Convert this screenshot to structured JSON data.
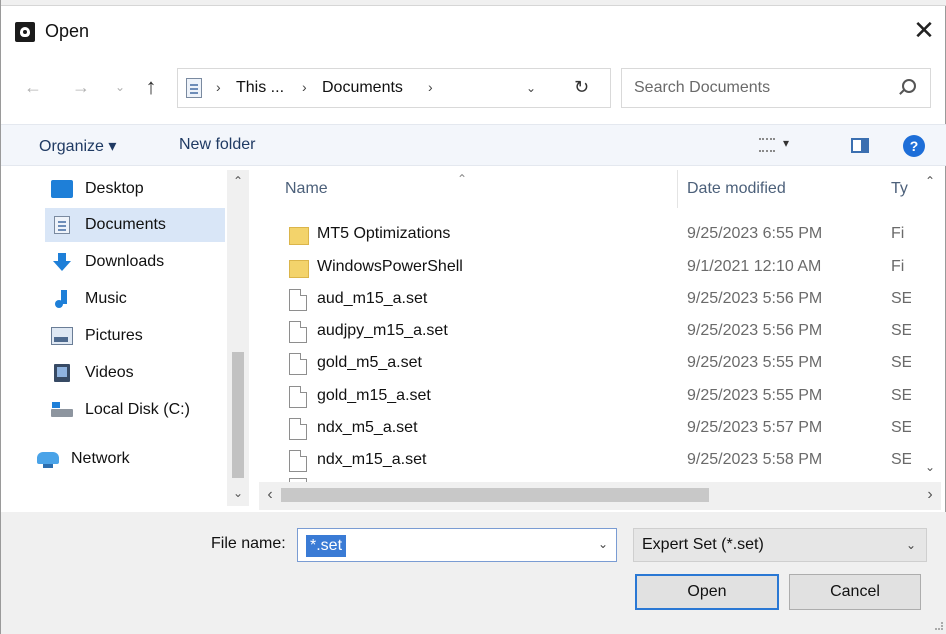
{
  "window": {
    "title": "Open",
    "close_glyph": "✕"
  },
  "nav": {
    "back_glyph": "←",
    "forward_glyph": "→",
    "recent_glyph": "⌄",
    "up_glyph": "↑",
    "breadcrumb": [
      "This ...",
      "Documents"
    ],
    "breadcrumb_sep": "›",
    "dropdown_glyph": "⌄",
    "refresh_glyph": "↻",
    "search_placeholder": "Search Documents"
  },
  "toolbar": {
    "organize_label": "Organize ▾",
    "new_folder_label": "New folder",
    "view_caret": "▾",
    "help_label": "?"
  },
  "sidebar": {
    "items": [
      {
        "label": "Desktop",
        "icon": "desktop-icon"
      },
      {
        "label": "Documents",
        "icon": "documents-icon",
        "selected": true
      },
      {
        "label": "Downloads",
        "icon": "downloads-icon"
      },
      {
        "label": "Music",
        "icon": "music-icon"
      },
      {
        "label": "Pictures",
        "icon": "pictures-icon"
      },
      {
        "label": "Videos",
        "icon": "videos-icon"
      },
      {
        "label": "Local Disk (C:)",
        "icon": "local-disk-icon"
      },
      {
        "label": "Network",
        "icon": "network-icon"
      }
    ],
    "scroll_up": "⌃",
    "scroll_down": "⌄"
  },
  "files": {
    "columns": {
      "name": "Name",
      "date": "Date modified",
      "type": "Ty"
    },
    "sort_caret": "⌃",
    "rows": [
      {
        "name": "MT5 Optimizations",
        "date": "9/25/2023 6:55 PM",
        "type": "Fi",
        "kind": "folder"
      },
      {
        "name": "WindowsPowerShell",
        "date": "9/1/2021 12:10 AM",
        "type": "Fi",
        "kind": "folder"
      },
      {
        "name": "aud_m15_a.set",
        "date": "9/25/2023 5:56 PM",
        "type": "SE",
        "kind": "file"
      },
      {
        "name": "audjpy_m15_a.set",
        "date": "9/25/2023 5:56 PM",
        "type": "SE",
        "kind": "file"
      },
      {
        "name": "gold_m5_a.set",
        "date": "9/25/2023 5:55 PM",
        "type": "SE",
        "kind": "file"
      },
      {
        "name": "gold_m15_a.set",
        "date": "9/25/2023 5:55 PM",
        "type": "SE",
        "kind": "file"
      },
      {
        "name": "ndx_m5_a.set",
        "date": "9/25/2023 5:57 PM",
        "type": "SE",
        "kind": "file"
      },
      {
        "name": "ndx_m15_a.set",
        "date": "9/25/2023 5:58 PM",
        "type": "SE",
        "kind": "file"
      }
    ],
    "vscroll_up": "⌃",
    "vscroll_down": "⌄",
    "hscroll_left": "‹",
    "hscroll_right": "›"
  },
  "footer": {
    "file_name_label": "File name:",
    "file_name_value": "*.set",
    "file_name_dd": "⌄",
    "file_type_value": "Expert Set (*.set)",
    "file_type_dd": "⌄",
    "open_label": "Open",
    "cancel_label": "Cancel"
  },
  "colors": {
    "accent": "#2a78d4",
    "selection": "#d9e6f7",
    "folder": "#f3d36b"
  }
}
